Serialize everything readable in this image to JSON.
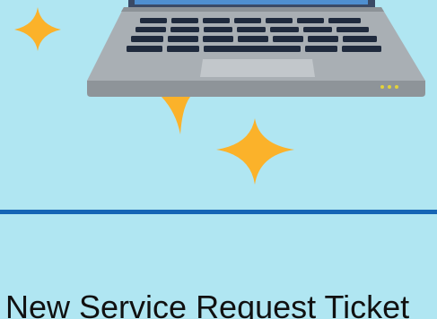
{
  "card": {
    "title": "New Service Request Ticket"
  },
  "colors": {
    "background": "#b0e6f2",
    "divider": "#1565b5",
    "sparkle": "#fbb22a",
    "laptop_body": "#9ea3a8",
    "laptop_keys": "#1f2a3d"
  },
  "icons": {
    "illustration": "laptop-icon",
    "sparkles": "sparkle-icon"
  }
}
